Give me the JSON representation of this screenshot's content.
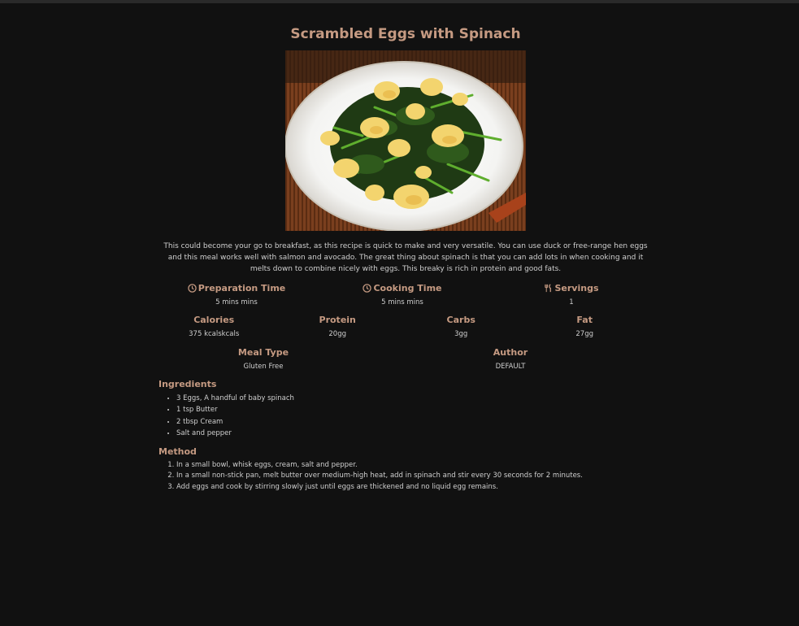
{
  "recipe": {
    "title": "Scrambled Eggs with Spinach",
    "image_alt": "plate of scrambled eggs with spinach",
    "description": "This could become your go to breakfast, as this recipe is quick to make and very versatile. You can use duck or free-range hen eggs and this meal works well with salmon and avocado. The great thing about spinach is that you can add lots in when cooking and it melts down to combine nicely with eggs. This breaky is rich in protein and good fats.",
    "times": {
      "prep_label": "Preparation Time",
      "prep_value": "5 mins mins",
      "cook_label": "Cooking Time",
      "cook_value": "5 mins mins",
      "servings_label": "Servings",
      "servings_value": "1"
    },
    "nutrition": {
      "calories_label": "Calories",
      "calories_value": "375 kcalskcals",
      "protein_label": "Protein",
      "protein_value": "20gg",
      "carbs_label": "Carbs",
      "carbs_value": "3gg",
      "fat_label": "Fat",
      "fat_value": "27gg"
    },
    "meta": {
      "meal_type_label": "Meal Type",
      "meal_type_value": "Gluten Free",
      "author_label": "Author",
      "author_value": "DEFAULT"
    },
    "ingredients_title": "Ingredients",
    "ingredients": [
      "3 Eggs, A handful of baby spinach",
      "1 tsp Butter",
      "2 tbsp Cream",
      "Salt and pepper"
    ],
    "method_title": "Method",
    "method": [
      "In a small bowl, whisk eggs, cream, salt and pepper.",
      "In a small non-stick pan, melt butter over medium-high heat, add in spinach and stir every 30 seconds for 2 minutes.",
      "Add eggs and cook by stirring slowly just until eggs are thickened and no liquid egg remains."
    ]
  },
  "icons": {
    "prep": "clock-icon",
    "cook": "clock-icon",
    "servings": "utensils-icon"
  },
  "colors": {
    "background": "#111111",
    "accent": "#c59a82",
    "text": "#cfcfcf"
  }
}
